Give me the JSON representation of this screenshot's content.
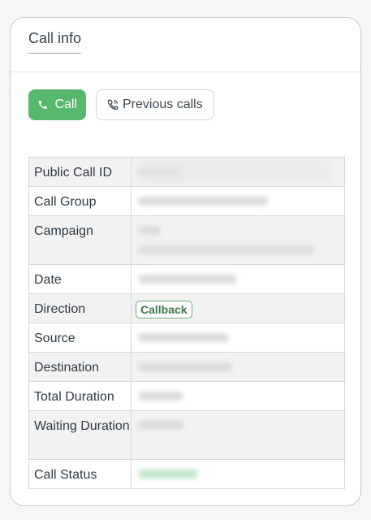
{
  "card": {
    "title": "Call info"
  },
  "buttons": {
    "call_label": "Call",
    "previous_calls_label": "Previous calls"
  },
  "colors": {
    "call_button": "#57b76b",
    "callback_badge_text": "#3d7a4a"
  },
  "details": {
    "rows": [
      {
        "label": "Public Call ID"
      },
      {
        "label": "Call Group"
      },
      {
        "label": "Campaign"
      },
      {
        "label": "Date"
      },
      {
        "label": "Direction",
        "badge": "Callback"
      },
      {
        "label": "Source"
      },
      {
        "label": "Destination"
      },
      {
        "label": "Total Duration"
      },
      {
        "label": "Waiting Duration"
      },
      {
        "label": "Call Status"
      }
    ]
  }
}
